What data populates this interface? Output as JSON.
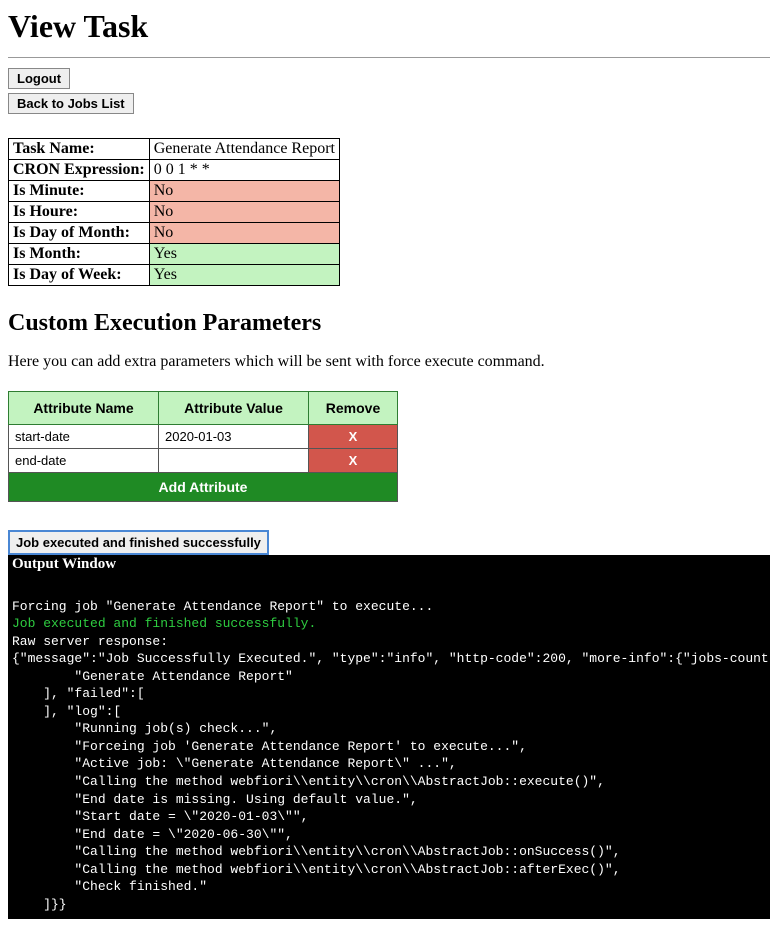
{
  "page": {
    "title": "View Task"
  },
  "buttons": {
    "logout": "Logout",
    "back": "Back to Jobs List"
  },
  "taskInfo": {
    "rows": [
      {
        "label": "Task Name:",
        "value": "Generate Attendance Report",
        "flag": ""
      },
      {
        "label": "CRON Expression:",
        "value": "0 0 1 * *",
        "flag": ""
      },
      {
        "label": "Is Minute:",
        "value": "No",
        "flag": "no"
      },
      {
        "label": "Is Houre:",
        "value": "No",
        "flag": "no"
      },
      {
        "label": "Is Day of Month:",
        "value": "No",
        "flag": "no"
      },
      {
        "label": "Is Month:",
        "value": "Yes",
        "flag": "yes"
      },
      {
        "label": "Is Day of Week:",
        "value": "Yes",
        "flag": "yes"
      }
    ]
  },
  "customParams": {
    "heading": "Custom Execution Parameters",
    "description": "Here you can add extra parameters which will be sent with force execute command.",
    "headers": {
      "name": "Attribute Name",
      "value": "Attribute Value",
      "remove": "Remove"
    },
    "rows": [
      {
        "name": "start-date",
        "value": "2020-01-03"
      },
      {
        "name": "end-date",
        "value": ""
      }
    ],
    "removeLabel": "X",
    "addLabel": "Add Attribute"
  },
  "status": {
    "text": "Job executed and finished successfully"
  },
  "output": {
    "title": "Output Window",
    "lines": [
      {
        "text": "",
        "color": ""
      },
      {
        "text": "Forcing job \"Generate Attendance Report\" to execute...",
        "color": ""
      },
      {
        "text": "Job executed and finished successfully.",
        "color": "green"
      },
      {
        "text": "Raw server response:",
        "color": ""
      },
      {
        "text": "{\"message\":\"Job Successfully Executed.\", \"type\":\"info\", \"http-code\":200, \"more-info\":{\"jobs-count\"",
        "color": ""
      },
      {
        "text": "        \"Generate Attendance Report\"",
        "color": ""
      },
      {
        "text": "    ], \"failed\":[",
        "color": ""
      },
      {
        "text": "    ], \"log\":[",
        "color": ""
      },
      {
        "text": "        \"Running job(s) check...\",",
        "color": ""
      },
      {
        "text": "        \"Forceing job 'Generate Attendance Report' to execute...\",",
        "color": ""
      },
      {
        "text": "        \"Active job: \\\"Generate Attendance Report\\\" ...\",",
        "color": ""
      },
      {
        "text": "        \"Calling the method webfiori\\\\entity\\\\cron\\\\AbstractJob::execute()\",",
        "color": ""
      },
      {
        "text": "        \"End date is missing. Using default value.\",",
        "color": ""
      },
      {
        "text": "        \"Start date = \\\"2020-01-03\\\"\",",
        "color": ""
      },
      {
        "text": "        \"End date = \\\"2020-06-30\\\"\",",
        "color": ""
      },
      {
        "text": "        \"Calling the method webfiori\\\\entity\\\\cron\\\\AbstractJob::onSuccess()\",",
        "color": ""
      },
      {
        "text": "        \"Calling the method webfiori\\\\entity\\\\cron\\\\AbstractJob::afterExec()\",",
        "color": ""
      },
      {
        "text": "        \"Check finished.\"",
        "color": ""
      },
      {
        "text": "    ]}}",
        "color": ""
      }
    ]
  }
}
